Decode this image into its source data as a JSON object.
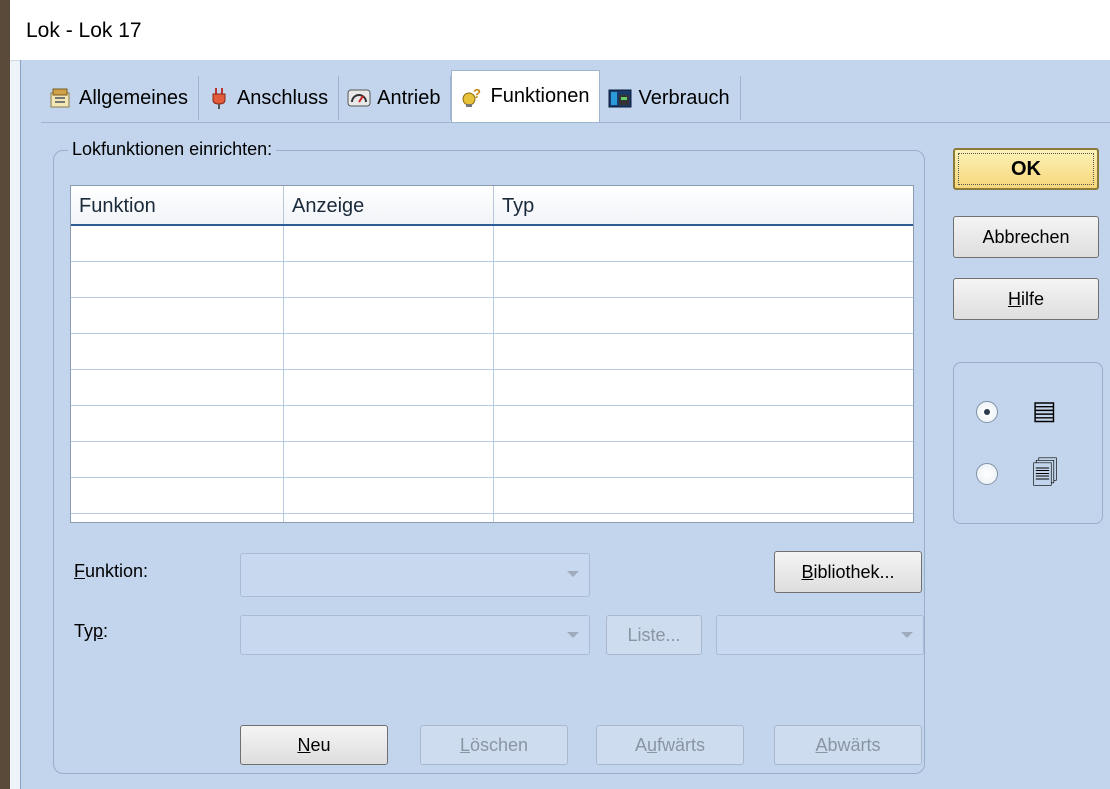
{
  "window": {
    "title": "Lok - Lok 17"
  },
  "tabs": [
    {
      "label": "Allgemeines",
      "icon": "properties-icon"
    },
    {
      "label": "Anschluss",
      "icon": "plug-icon"
    },
    {
      "label": "Antrieb",
      "icon": "gauge-icon"
    },
    {
      "label": "Funktionen",
      "icon": "bulb-icon",
      "active": true
    },
    {
      "label": "Verbrauch",
      "icon": "consumption-icon"
    }
  ],
  "group": {
    "label": "Lokfunktionen einrichten:",
    "columns": [
      "Funktion",
      "Anzeige",
      "Typ"
    ],
    "row_count": 8
  },
  "form": {
    "funktion_label_first": "F",
    "funktion_label_rest": "unktion:",
    "funktion_value": "",
    "typ_label_pre": "Ty",
    "typ_label_u": "p",
    "typ_label_post": ":",
    "typ_value": "",
    "typ_extra_value": "",
    "liste_button": "Liste...",
    "bibliothek_u": "B",
    "bibliothek_rest": "ibliothek..."
  },
  "actions": {
    "neu_u": "N",
    "neu_rest": "eu",
    "loeschen_u": "L",
    "loeschen_rest": "öschen",
    "aufwaerts_pre": "A",
    "aufwaerts_u": "u",
    "aufwaerts_rest": "fwärts",
    "abwaerts_u": "A",
    "abwaerts_rest": "bwärts"
  },
  "dialog_buttons": {
    "ok": "OK",
    "abbrechen": "Abbrechen",
    "hilfe_u": "H",
    "hilfe_rest": "ilfe"
  },
  "view_mode": {
    "options": [
      {
        "icon": "list-view-icon",
        "glyph": "▤",
        "selected": true
      },
      {
        "icon": "cascade-view-icon",
        "glyph": "🗐",
        "selected": false
      }
    ]
  },
  "colors": {
    "dialog_bg": "#c3d5ec",
    "grid_header_underline": "#2f5c97",
    "ok_button": "#f6d77a"
  }
}
